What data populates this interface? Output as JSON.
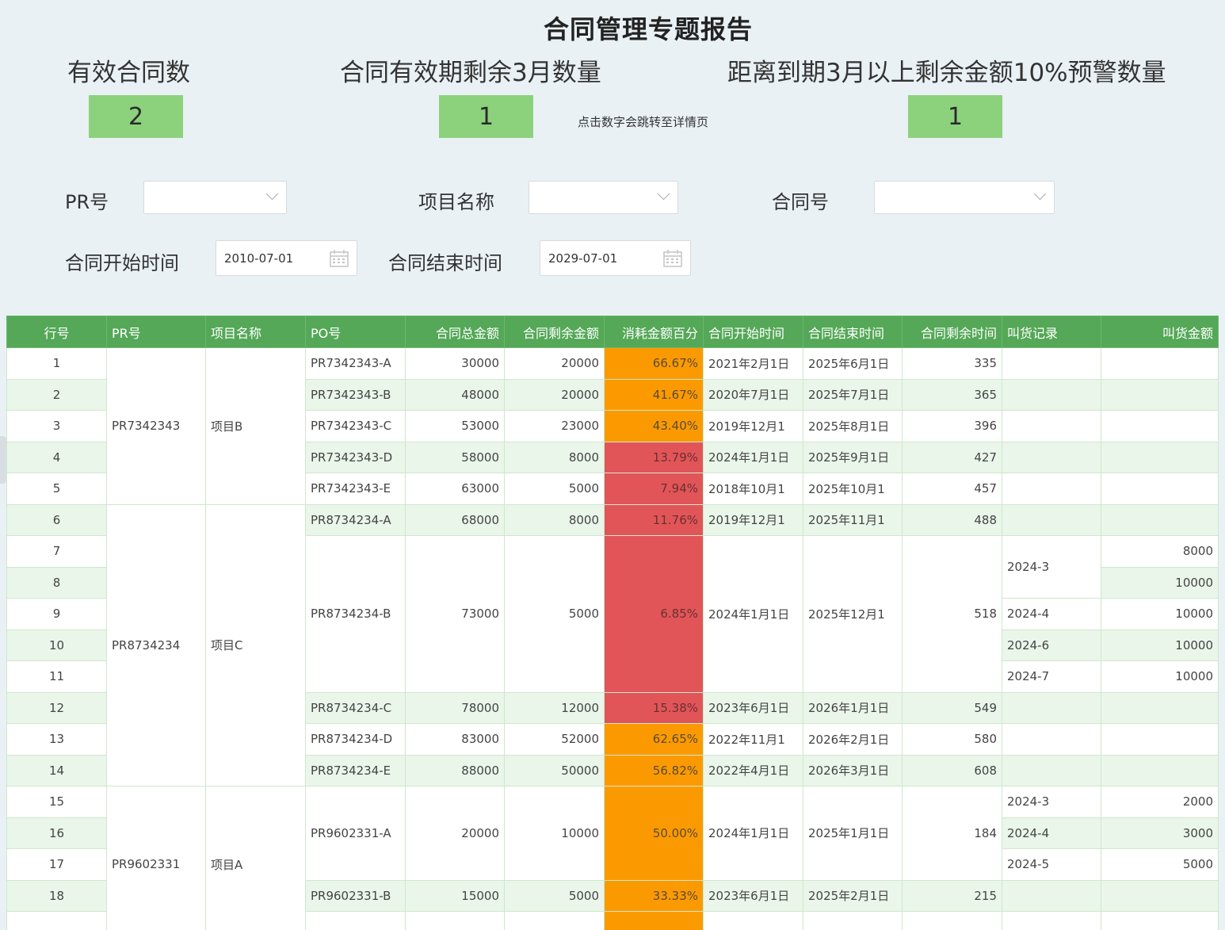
{
  "title": "合同管理专题报告",
  "kpis": [
    {
      "label": "有效合同数",
      "value": "2"
    },
    {
      "label": "合同有效期剩余3月数量",
      "value": "1"
    },
    {
      "label": "距离到期3月以上剩余金额10%预警数量",
      "value": "1"
    }
  ],
  "hint": "点击数字会跳转至详情页",
  "filters": {
    "pr_label": "PR号",
    "project_label": "项目名称",
    "contract_label": "合同号",
    "start_label": "合同开始时间",
    "start_value": "2010-07-01",
    "end_label": "合同结束时间",
    "end_value": "2029-07-01"
  },
  "colors": {
    "orange": "#fb9a00",
    "red": "#e15558",
    "header": "#54a857",
    "kpi": "#8cd27c"
  },
  "table": {
    "headers": [
      "行号",
      "PR号",
      "项目名称",
      "PO号",
      "合同总金额",
      "合同剩余金额",
      "消耗金额百分",
      "合同开始时间",
      "合同结束时间",
      "合同剩余时间",
      "叫货记录",
      "叫货金额"
    ],
    "rows": [
      {
        "n": "1",
        "pr": "PR7342343",
        "proj": "项目B",
        "po": "PR7342343-A",
        "total": "30000",
        "remain": "20000",
        "pct": "66.67%",
        "level": "orange",
        "start": "2021年2月1日",
        "end": "2025年6月1日",
        "days": "335",
        "rec": "",
        "amt": ""
      },
      {
        "n": "2",
        "pr": "",
        "proj": "",
        "po": "PR7342343-B",
        "total": "48000",
        "remain": "20000",
        "pct": "41.67%",
        "level": "orange",
        "start": "2020年7月1日",
        "end": "2025年7月1日",
        "days": "365",
        "rec": "",
        "amt": ""
      },
      {
        "n": "3",
        "pr": "",
        "proj": "",
        "po": "PR7342343-C",
        "total": "53000",
        "remain": "23000",
        "pct": "43.40%",
        "level": "orange",
        "start": "2019年12月1",
        "end": "2025年8月1日",
        "days": "396",
        "rec": "",
        "amt": ""
      },
      {
        "n": "4",
        "pr": "",
        "proj": "",
        "po": "PR7342343-D",
        "total": "58000",
        "remain": "8000",
        "pct": "13.79%",
        "level": "red",
        "start": "2024年1月1日",
        "end": "2025年9月1日",
        "days": "427",
        "rec": "",
        "amt": ""
      },
      {
        "n": "5",
        "pr": "",
        "proj": "",
        "po": "PR7342343-E",
        "total": "63000",
        "remain": "5000",
        "pct": "7.94%",
        "level": "red",
        "start": "2018年10月1",
        "end": "2025年10月1",
        "days": "457",
        "rec": "",
        "amt": ""
      },
      {
        "n": "6",
        "pr": "PR8734234",
        "proj": "项目C",
        "po": "PR8734234-A",
        "total": "68000",
        "remain": "8000",
        "pct": "11.76%",
        "level": "red",
        "start": "2019年12月1",
        "end": "2025年11月1",
        "days": "488",
        "rec": "",
        "amt": ""
      },
      {
        "n": "7",
        "pr": "",
        "proj": "",
        "po": "PR8734234-B",
        "total": "73000",
        "remain": "5000",
        "pct": "6.85%",
        "level": "red",
        "start": "2024年1月1日",
        "end": "2025年12月1",
        "days": "518",
        "rec": "2024-3",
        "amt": "8000"
      },
      {
        "n": "8",
        "pr": "",
        "proj": "",
        "po": "",
        "total": "",
        "remain": "",
        "pct": "",
        "level": "",
        "start": "",
        "end": "",
        "days": "",
        "rec": "",
        "amt": "10000"
      },
      {
        "n": "9",
        "pr": "",
        "proj": "",
        "po": "",
        "total": "",
        "remain": "",
        "pct": "",
        "level": "",
        "start": "",
        "end": "",
        "days": "",
        "rec": "2024-4",
        "amt": "10000"
      },
      {
        "n": "10",
        "pr": "",
        "proj": "",
        "po": "",
        "total": "",
        "remain": "",
        "pct": "",
        "level": "",
        "start": "",
        "end": "",
        "days": "",
        "rec": "2024-6",
        "amt": "10000"
      },
      {
        "n": "11",
        "pr": "",
        "proj": "",
        "po": "",
        "total": "",
        "remain": "",
        "pct": "",
        "level": "",
        "start": "",
        "end": "",
        "days": "",
        "rec": "2024-7",
        "amt": "10000"
      },
      {
        "n": "12",
        "pr": "",
        "proj": "",
        "po": "PR8734234-C",
        "total": "78000",
        "remain": "12000",
        "pct": "15.38%",
        "level": "red",
        "start": "2023年6月1日",
        "end": "2026年1月1日",
        "days": "549",
        "rec": "",
        "amt": ""
      },
      {
        "n": "13",
        "pr": "",
        "proj": "",
        "po": "PR8734234-D",
        "total": "83000",
        "remain": "52000",
        "pct": "62.65%",
        "level": "orange",
        "start": "2022年11月1",
        "end": "2026年2月1日",
        "days": "580",
        "rec": "",
        "amt": ""
      },
      {
        "n": "14",
        "pr": "",
        "proj": "",
        "po": "PR8734234-E",
        "total": "88000",
        "remain": "50000",
        "pct": "56.82%",
        "level": "orange",
        "start": "2022年4月1日",
        "end": "2026年3月1日",
        "days": "608",
        "rec": "",
        "amt": ""
      },
      {
        "n": "15",
        "pr": "PR9602331",
        "proj": "项目A",
        "po": "PR9602331-A",
        "total": "20000",
        "remain": "10000",
        "pct": "50.00%",
        "level": "orange",
        "start": "2024年1月1日",
        "end": "2025年1月1日",
        "days": "184",
        "rec": "2024-3",
        "amt": "2000"
      },
      {
        "n": "16",
        "pr": "",
        "proj": "",
        "po": "",
        "total": "",
        "remain": "",
        "pct": "",
        "level": "",
        "start": "",
        "end": "",
        "days": "",
        "rec": "2024-4",
        "amt": "3000"
      },
      {
        "n": "17",
        "pr": "",
        "proj": "",
        "po": "",
        "total": "",
        "remain": "",
        "pct": "",
        "level": "",
        "start": "",
        "end": "",
        "days": "",
        "rec": "2024-5",
        "amt": "5000"
      },
      {
        "n": "18",
        "pr": "",
        "proj": "",
        "po": "PR9602331-B",
        "total": "15000",
        "remain": "5000",
        "pct": "33.33%",
        "level": "orange",
        "start": "2023年6月1日",
        "end": "2025年2月1日",
        "days": "215",
        "rec": "",
        "amt": ""
      },
      {
        "n": "",
        "pr": "",
        "proj": "",
        "po": "",
        "total": "",
        "remain": "",
        "pct": "",
        "level": "orange",
        "start": "",
        "end": "",
        "days": "",
        "rec": "",
        "amt": ""
      }
    ]
  }
}
